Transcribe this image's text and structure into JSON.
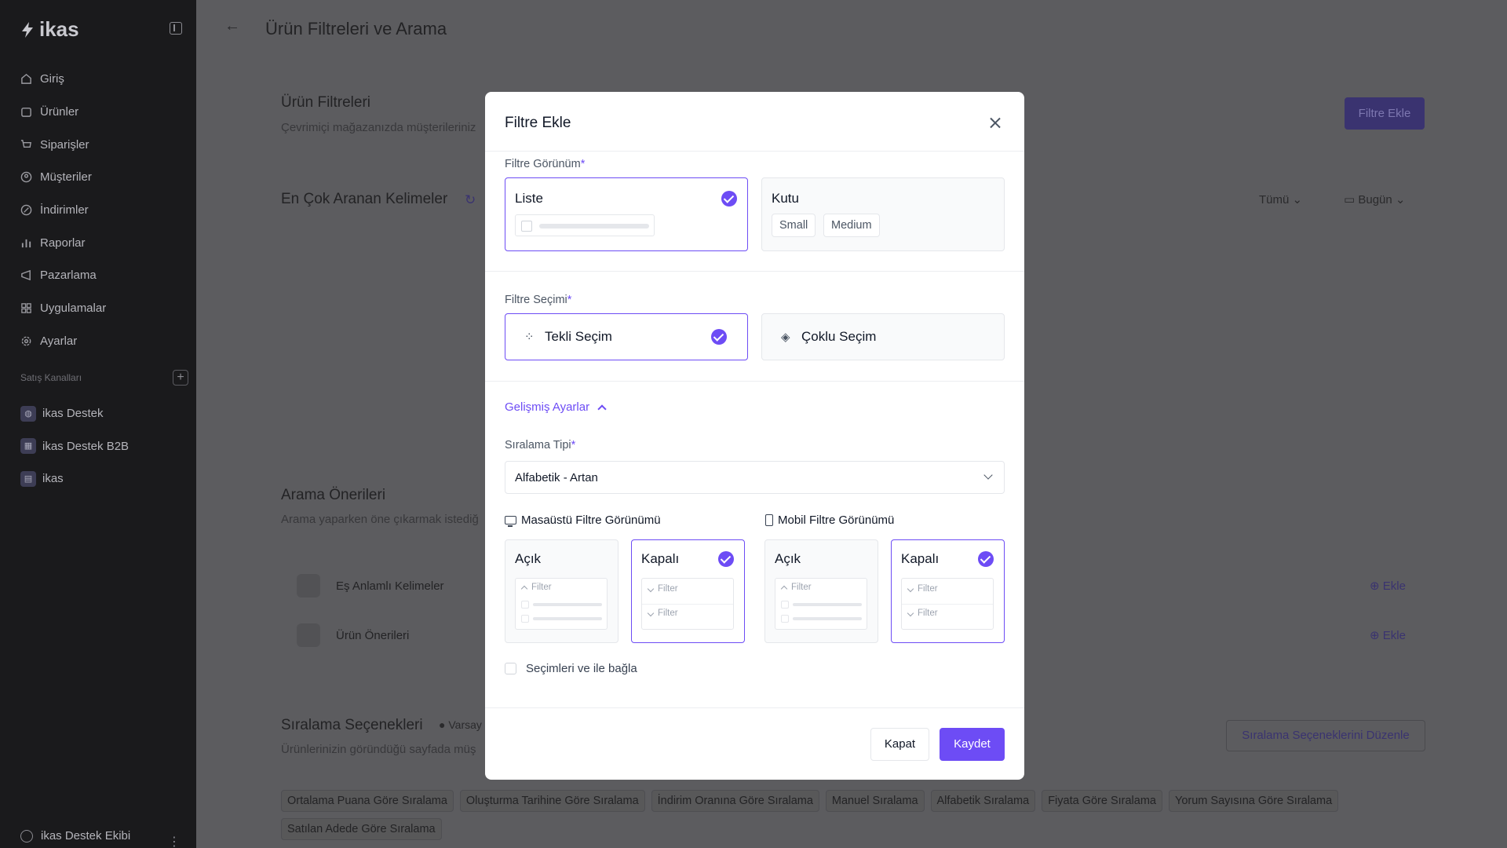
{
  "sidebar": {
    "logo": "ikas",
    "nav": [
      {
        "label": "Giriş",
        "icon": "home-icon"
      },
      {
        "label": "Ürünler",
        "icon": "box-icon"
      },
      {
        "label": "Siparişler",
        "icon": "cart-icon"
      },
      {
        "label": "Müşteriler",
        "icon": "user-icon"
      },
      {
        "label": "İndirimler",
        "icon": "discount-icon"
      },
      {
        "label": "Raporlar",
        "icon": "chart-icon"
      },
      {
        "label": "Pazarlama",
        "icon": "megaphone-icon"
      },
      {
        "label": "Uygulamalar",
        "icon": "grid-icon"
      },
      {
        "label": "Ayarlar",
        "icon": "gear-icon"
      }
    ],
    "channels_title": "Satış Kanalları",
    "channels": [
      {
        "label": "ikas Destek",
        "icon": "globe-icon"
      },
      {
        "label": "ikas Destek B2B",
        "icon": "store-icon"
      },
      {
        "label": "ikas",
        "icon": "pos-icon"
      }
    ],
    "user": "ikas Destek Ekibi"
  },
  "main": {
    "title": "Ürün Filtreleri ve Arama",
    "filters_title": "Ürün Filtreleri",
    "filters_sub": "Çevrimiçi mağazanızda müşterileriniz",
    "add_filter": "Filtre Ekle",
    "keywords_title": "En Çok Aranan Kelimeler",
    "filter_all": "Tümü",
    "filter_today": "Bugün",
    "suggestions_title": "Arama Önerileri",
    "suggestions_sub": "Arama yaparken öne çıkarmak istediğ",
    "rows": [
      "Eş Anlamlı Kelimeler",
      "Ürün Önerileri"
    ],
    "add_label": "Ekle",
    "sort_title": "Sıralama Seçenekleri",
    "sort_badge": "Varsay",
    "sort_sub": "Ürünlerinizin göründüğü sayfada müş",
    "sort_edit": "Sıralama Seçeneklerini Düzenle",
    "chips": [
      "Ortalama Puana Göre Sıralama",
      "Oluşturma Tarihine Göre Sıralama",
      "İndirim Oranına Göre Sıralama",
      "Manuel Sıralama",
      "Alfabetik Sıralama",
      "Fiyata Göre Sıralama",
      "Yorum Sayısına Göre Sıralama",
      "Satılan Adede Göre Sıralama"
    ]
  },
  "modal": {
    "title": "Filtre Ekle",
    "view_label": "Filtre Görünüm",
    "view_list": "Liste",
    "view_box": "Kutu",
    "size_small": "Small",
    "size_medium": "Medium",
    "selection_label": "Filtre Seçimi",
    "single": "Tekli Seçim",
    "multi": "Çoklu Seçim",
    "advanced": "Gelişmiş Ayarlar",
    "sort_type_label": "Sıralama Tipi",
    "sort_type_value": "Alfabetik - Artan",
    "desktop_view": "Masaüstü Filtre Görünümü",
    "mobile_view": "Mobil Filtre Görünümü",
    "open": "Açık",
    "closed": "Kapalı",
    "mini_filter": "Filter",
    "connect_and": "Seçimleri ve ile bağla",
    "close_btn": "Kapat",
    "save_btn": "Kaydet",
    "required_mark": "*"
  },
  "colors": {
    "accent": "#6d4cf5",
    "sidebar": "#1a1a1c",
    "overlay": "#5c5c5f"
  }
}
